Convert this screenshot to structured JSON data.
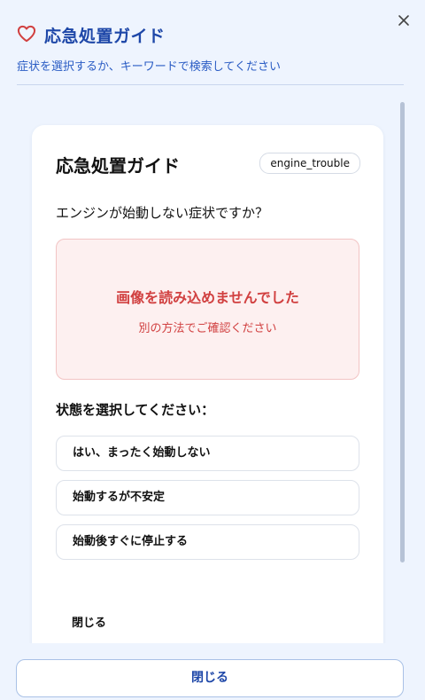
{
  "header": {
    "title": "応急処置ガイド",
    "subtitle": "症状を選択するか、キーワードで検索してください",
    "icon": "heart-icon",
    "close_icon": "close-icon"
  },
  "card": {
    "title": "応急処置ガイド",
    "badge": "engine_trouble",
    "question": "エンジンが始動しない症状ですか？",
    "error": {
      "title": "画像を読み込めませんでした",
      "subtitle": "別の方法でご確認ください"
    },
    "section_label": "状態を選択してください：",
    "options": [
      {
        "label": "はい、まったく始動しない"
      },
      {
        "label": "始動するが不安定"
      },
      {
        "label": "始動後すぐに停止する"
      }
    ],
    "close_label": "閉じる"
  },
  "footer": {
    "close_label": "閉じる"
  },
  "colors": {
    "accent": "#1e47a8",
    "heart": "#d14040",
    "error": "#d14040",
    "background": "#eef4fe"
  }
}
